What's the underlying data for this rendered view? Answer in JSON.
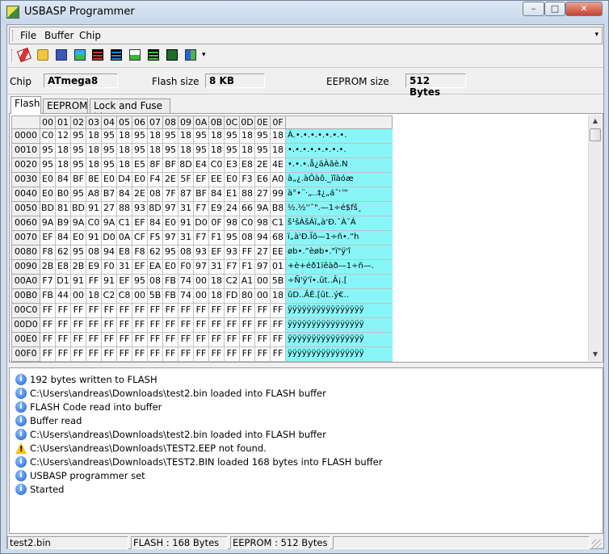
{
  "window": {
    "title": "USBASP Programmer",
    "min": "–",
    "max": "□",
    "close": "✕"
  },
  "menu": {
    "file": "File",
    "buffer": "Buffer",
    "chip": "Chip",
    "overflow": "▾"
  },
  "toolbar": {
    "overflow": "▾",
    "buttons": [
      "eraser-icon",
      "open-folder-icon",
      "save-icon",
      "write-icon",
      "read-chip-icon",
      "verify-icon",
      "flash-icon",
      "read-buffer-icon",
      "chip-icon",
      "settings-icon"
    ]
  },
  "chipinfo": {
    "chip_label": "Chip",
    "chip_value": "ATmega8",
    "flash_label": "Flash size",
    "flash_value": "8 KB",
    "eeprom_label": "EEPROM size",
    "eeprom_value": "512 Bytes"
  },
  "tabs": [
    "Flash",
    "EEPROM",
    "Lock and Fuse bits"
  ],
  "hex": {
    "columns": [
      "00",
      "01",
      "02",
      "03",
      "04",
      "05",
      "06",
      "07",
      "08",
      "09",
      "0A",
      "0B",
      "0C",
      "0D",
      "0E",
      "0F"
    ],
    "rows": [
      {
        "addr": "0000",
        "bytes": [
          "C0",
          "12",
          "95",
          "18",
          "95",
          "18",
          "95",
          "18",
          "95",
          "18",
          "95",
          "18",
          "95",
          "18",
          "95",
          "18"
        ],
        "ascii": "À.•.•.•.•.•.•.•."
      },
      {
        "addr": "0010",
        "bytes": [
          "95",
          "18",
          "95",
          "18",
          "95",
          "18",
          "95",
          "18",
          "95",
          "18",
          "95",
          "18",
          "95",
          "18",
          "95",
          "18"
        ],
        "ascii": "•.•.•.•.•.•.•.•."
      },
      {
        "addr": "0020",
        "bytes": [
          "95",
          "18",
          "95",
          "18",
          "95",
          "18",
          "E5",
          "8F",
          "BF",
          "8D",
          "E4",
          "C0",
          "E3",
          "E8",
          "2E",
          "4E"
        ],
        "ascii": "•.•.•.å¿äÀãè.N"
      },
      {
        "addr": "0030",
        "bytes": [
          "E0",
          "84",
          "BF",
          "8E",
          "E0",
          "D4",
          "E0",
          "F4",
          "2E",
          "5F",
          "EF",
          "EE",
          "E0",
          "F3",
          "E6",
          "A0"
        ],
        "ascii": "à„¿.àÔàô._ïîàóæ "
      },
      {
        "addr": "0040",
        "bytes": [
          "E0",
          "B0",
          "95",
          "A8",
          "B7",
          "84",
          "2E",
          "08",
          "7F",
          "87",
          "BF",
          "84",
          "E1",
          "88",
          "27",
          "99"
        ],
        "ascii": "à°•¨·„..‡¿„áˆ'™"
      },
      {
        "addr": "0050",
        "bytes": [
          "BD",
          "81",
          "BD",
          "91",
          "27",
          "88",
          "93",
          "8D",
          "97",
          "31",
          "F7",
          "E9",
          "24",
          "66",
          "9A",
          "B8"
        ],
        "ascii": "½.½''ˆ\".—1÷é$fš¸"
      },
      {
        "addr": "0060",
        "bytes": [
          "9A",
          "B9",
          "9A",
          "C0",
          "9A",
          "C1",
          "EF",
          "84",
          "E0",
          "91",
          "D0",
          "0F",
          "98",
          "C0",
          "98",
          "C1"
        ],
        "ascii": "š¹šÀšÁï„à'Ð.˜À˜Á"
      },
      {
        "addr": "0070",
        "bytes": [
          "EF",
          "84",
          "E0",
          "91",
          "D0",
          "0A",
          "CF",
          "F5",
          "97",
          "31",
          "F7",
          "F1",
          "95",
          "08",
          "94",
          "68"
        ],
        "ascii": "ï„à'Ð.Ïõ—1÷ñ•.”h"
      },
      {
        "addr": "0080",
        "bytes": [
          "F8",
          "62",
          "95",
          "08",
          "94",
          "E8",
          "F8",
          "62",
          "95",
          "08",
          "93",
          "EF",
          "93",
          "FF",
          "27",
          "EE"
        ],
        "ascii": "øb•.”èøb•.\"ï\"ÿ'î"
      },
      {
        "addr": "0090",
        "bytes": [
          "2B",
          "E8",
          "2B",
          "E9",
          "F0",
          "31",
          "EF",
          "EA",
          "E0",
          "F0",
          "97",
          "31",
          "F7",
          "F1",
          "97",
          "01"
        ],
        "ascii": "+è+éð1ïêàð—1÷ñ—."
      },
      {
        "addr": "00A0",
        "bytes": [
          "F7",
          "D1",
          "91",
          "FF",
          "91",
          "EF",
          "95",
          "08",
          "FB",
          "74",
          "00",
          "18",
          "C2",
          "A1",
          "00",
          "5B"
        ],
        "ascii": "÷Ñ'ÿ'ï•.ût..Â¡.["
      },
      {
        "addr": "00B0",
        "bytes": [
          "FB",
          "44",
          "00",
          "18",
          "C2",
          "C8",
          "00",
          "5B",
          "FB",
          "74",
          "00",
          "18",
          "FD",
          "80",
          "00",
          "18"
        ],
        "ascii": "ûD..ÂÈ.[ût..ý€.."
      },
      {
        "addr": "00C0",
        "bytes": [
          "FF",
          "FF",
          "FF",
          "FF",
          "FF",
          "FF",
          "FF",
          "FF",
          "FF",
          "FF",
          "FF",
          "FF",
          "FF",
          "FF",
          "FF",
          "FF"
        ],
        "ascii": "ÿÿÿÿÿÿÿÿÿÿÿÿÿÿÿÿ"
      },
      {
        "addr": "00D0",
        "bytes": [
          "FF",
          "FF",
          "FF",
          "FF",
          "FF",
          "FF",
          "FF",
          "FF",
          "FF",
          "FF",
          "FF",
          "FF",
          "FF",
          "FF",
          "FF",
          "FF"
        ],
        "ascii": "ÿÿÿÿÿÿÿÿÿÿÿÿÿÿÿÿ"
      },
      {
        "addr": "00E0",
        "bytes": [
          "FF",
          "FF",
          "FF",
          "FF",
          "FF",
          "FF",
          "FF",
          "FF",
          "FF",
          "FF",
          "FF",
          "FF",
          "FF",
          "FF",
          "FF",
          "FF"
        ],
        "ascii": "ÿÿÿÿÿÿÿÿÿÿÿÿÿÿÿÿ"
      },
      {
        "addr": "00F0",
        "bytes": [
          "FF",
          "FF",
          "FF",
          "FF",
          "FF",
          "FF",
          "FF",
          "FF",
          "FF",
          "FF",
          "FF",
          "FF",
          "FF",
          "FF",
          "FF",
          "FF"
        ],
        "ascii": "ÿÿÿÿÿÿÿÿÿÿÿÿÿÿÿÿ"
      }
    ]
  },
  "log": [
    {
      "type": "info",
      "text": "192 bytes written to FLASH"
    },
    {
      "type": "info",
      "text": "C:\\Users\\andreas\\Downloads\\test2.bin loaded into FLASH buffer"
    },
    {
      "type": "info",
      "text": "FLASH Code read into buffer"
    },
    {
      "type": "info",
      "text": "Buffer read"
    },
    {
      "type": "info",
      "text": "C:\\Users\\andreas\\Downloads\\test2.bin loaded into FLASH buffer"
    },
    {
      "type": "warn",
      "text": "C:\\Users\\andreas\\Downloads\\TEST2.EEP not found."
    },
    {
      "type": "info",
      "text": "C:\\Users\\andreas\\Downloads\\TEST2.BIN loaded 168 bytes into FLASH buffer"
    },
    {
      "type": "info",
      "text": "USBASP programmer set"
    },
    {
      "type": "info",
      "text": "Started"
    }
  ],
  "status": {
    "file": "test2.bin",
    "flash": "FLASH : 168 Bytes",
    "eeprom": "EEPROM : 512 Bytes",
    "extra": ""
  },
  "colors": {
    "ascii_bg": "#88f6f8",
    "info_icon": "#1b5fcf",
    "warn_icon": "#f2c31b"
  }
}
